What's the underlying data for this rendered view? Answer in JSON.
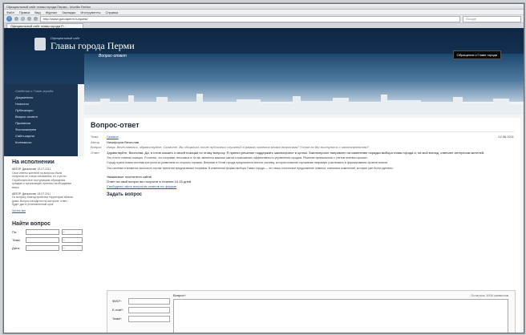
{
  "browser": {
    "title": "Официальный сайт главы города Перми - Mozilla Firefox",
    "menu": [
      "Файл",
      "Правка",
      "Вид",
      "Журнал",
      "Закладки",
      "Инструменты",
      "Справка"
    ],
    "url": "http://www.gorodperm.ru/quest/",
    "search_placeholder": "Google",
    "tab_label": "Официальный сайт главы города П..."
  },
  "header": {
    "subtitle": "Официальный сайт",
    "title": "Главы города Перми",
    "appeal_button": "Обращения к Главе города"
  },
  "sidebar": {
    "items": [
      {
        "label": "Сведения о Главе города"
      },
      {
        "label": "Документы"
      },
      {
        "label": "Новости"
      },
      {
        "label": "Публикации"
      },
      {
        "label": "Вопрос-ответ"
      },
      {
        "label": "Приемная"
      },
      {
        "label": "Фотогалерея"
      },
      {
        "label": "Сайт-карта"
      },
      {
        "label": "Контакты"
      }
    ]
  },
  "banner": {
    "label": "Вопрос-ответ"
  },
  "left_pane": {
    "title": "На исполнении",
    "news": [
      {
        "meta": "АВТОР: Дисконтинг",
        "date": "18.07.2011",
        "text": "Свои ответы жителей на вопросы были получены не только письменно, но и устно. Отработаны все поступившие обращения граждан и организаций, приняты необходимые меры."
      },
      {
        "meta": "АВТОР: Дисконтинг",
        "date": "18.07.2011",
        "text": "По вопросу благоустройства территории вблизи дома. Вопрос находится на контроле, ответ будет дан в установленный срок."
      }
    ],
    "all_link": "Читать все",
    "find_title": "Найти вопрос",
    "find_fields": [
      {
        "label": "По:",
        "select": "—"
      },
      {
        "label": "Тема:",
        "select": "—"
      },
      {
        "label": "Дата:",
        "select": "—"
      }
    ]
  },
  "main": {
    "page_title": "Вопрос-ответ",
    "theme_label": "Тема",
    "theme_value": "Газовое",
    "date": "22.06.2011",
    "author_label": "Автор",
    "author_value": "Никифоров Вячеслав",
    "question_label": "Вопрос",
    "question_text": "Игорь Вячеславович, здравствуйте. Скажите, Вы общались после публичных слушаний в рамках проекта моими вопросами? Готов ли Вы выступить с законопроектом?",
    "answer_label": "Ответ",
    "answer_paragraphs": [
      "Здравствуйте, Вячеслав. Да, я готов сказать о своей позиции по этому вопросу. Я принял решение поддержать законопроект в целом. Законопроект направлен на изменение порядка выбора главы города и, на мой взгляд, отвечает интересам жителей.",
      "Это и есть главная позиция. Я считаю, что поправки, вносимые в Устав, являются важным шагом к повышению эффективности управления городом. Решение принималось с учетом мнения горожан.",
      "Городу нужна новая система контроля за развитием по стороны горожан. Впервые в Устав города предлагается внести систему, которая позволит горожанам напрямую участвовать в формировании органов власти.",
      "Эта система становится залогом в случае принятия предлагаемых поправок. В изменении формы выбора Главы города — это лишь логическое продолжение главных, ключевых изменений, которые уже были сделаны."
    ],
    "links": [
      {
        "text": "Уважаемые посетители сайта!",
        "underline": false
      },
      {
        "text": "Ответ на свой вопрос вы получите в течение 10-15 дней.",
        "underline": false
      },
      {
        "text": "Свободная часть вопросов-ответов на форуме",
        "underline": true
      }
    ],
    "ask_title": "Задать вопрос",
    "form": {
      "name_label": "ФИО*:",
      "email_label": "E-mail*:",
      "theme_label": "Тема*:",
      "question_label": "Вопрос*:",
      "counter": "Осталось 1000 символов"
    }
  }
}
